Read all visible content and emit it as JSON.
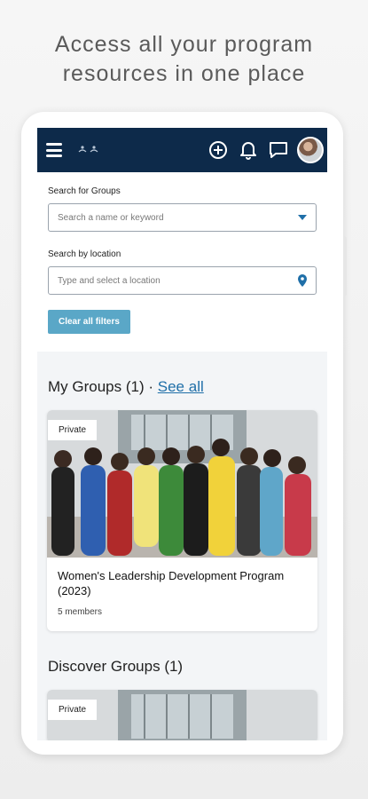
{
  "headline": {
    "line1": "Access all your program",
    "line2": "resources in one place"
  },
  "topbar": {
    "logo_text": "ꔰ ꔱ",
    "icons": [
      "menu-icon",
      "add-circle-icon",
      "bell-icon",
      "chat-icon",
      "avatar"
    ]
  },
  "filters": {
    "group_label": "Search for Groups",
    "group_placeholder": "Search a name or keyword",
    "location_label": "Search by location",
    "location_placeholder": "Type and select a location",
    "clear_label": "Clear all filters"
  },
  "my_groups": {
    "title": "My Groups (1) ·",
    "see_all": "See all",
    "card": {
      "badge": "Private",
      "title": "Women's Leadership Development Program (2023)",
      "members": "5 members"
    }
  },
  "discover": {
    "title": "Discover Groups (1)",
    "card": {
      "badge": "Private"
    }
  },
  "colors": {
    "topbar": "#0d2a4a",
    "accent_button": "#5aa7c7",
    "link": "#1f6fa8",
    "dropdown_arrow": "#1f6fa8"
  }
}
